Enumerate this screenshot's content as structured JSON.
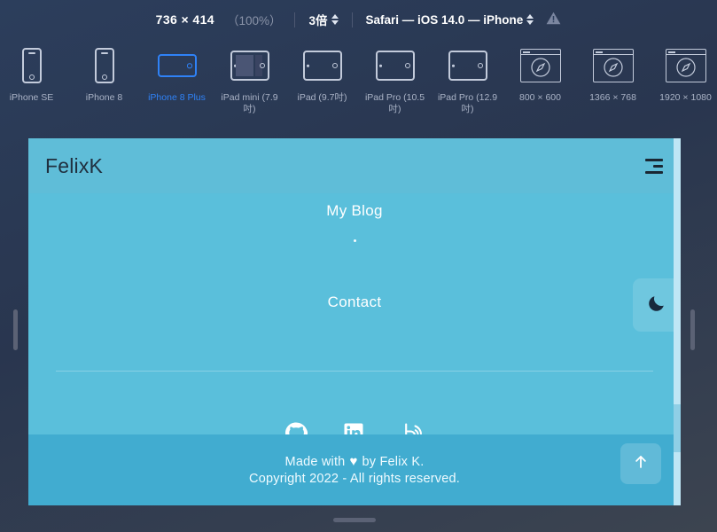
{
  "toolbar": {
    "size": "736 × 414",
    "percent": "（100%）",
    "scale": "3倍",
    "user_agent": "Safari — iOS 14.0 — iPhone",
    "warning_icon": "warning-triangle-icon"
  },
  "devices": [
    {
      "label": "iPhone SE",
      "type": "phone-portrait",
      "selected": false
    },
    {
      "label": "iPhone 8",
      "type": "phone-portrait",
      "selected": false
    },
    {
      "label": "iPhone 8 Plus",
      "type": "phone-landscape",
      "selected": true
    },
    {
      "label": "iPad mini (7.9吋)",
      "type": "tablet-split",
      "selected": false
    },
    {
      "label": "iPad (9.7吋)",
      "type": "tablet",
      "selected": false
    },
    {
      "label": "iPad Pro (10.5吋)",
      "type": "tablet",
      "selected": false
    },
    {
      "label": "iPad Pro (12.9吋)",
      "type": "tablet",
      "selected": false
    },
    {
      "label": "800 × 600",
      "type": "browser",
      "selected": false
    },
    {
      "label": "1366 × 768",
      "type": "browser",
      "selected": false
    },
    {
      "label": "1920 × 1080",
      "type": "browser",
      "selected": false
    }
  ],
  "site": {
    "brand": "FelixK",
    "menu_icon": "hamburger-menu-icon",
    "nav": [
      {
        "label": "My Blog"
      },
      {
        "label": "Contact"
      }
    ],
    "dark_mode_icon": "moon-icon",
    "socials": [
      {
        "name": "github-icon"
      },
      {
        "name": "linkedin-icon"
      },
      {
        "name": "blog-icon"
      }
    ],
    "footer": {
      "line1_prefix": "Made with",
      "heart": "♥",
      "line1_suffix": "by Felix K.",
      "line2": "Copyright 2022 - All rights reserved.",
      "to_top_icon": "arrow-up-icon"
    }
  },
  "colors": {
    "chrome_bg": "#2c3e5c",
    "accent_selected": "#2f82f7",
    "site_header": "#5FBDD8",
    "site_body": "#5ABFDB",
    "site_footer": "#41ACD0",
    "icon_outline": "#c3cbdb"
  }
}
